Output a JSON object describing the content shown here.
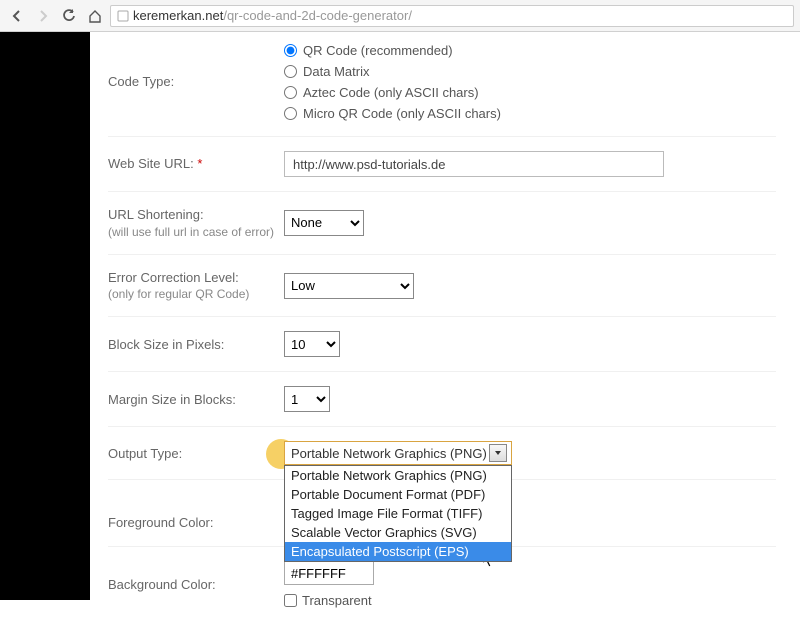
{
  "browser": {
    "url_host": "keremerkan.net",
    "url_path": "/qr-code-and-2d-code-generator/"
  },
  "form": {
    "code_type": {
      "label": "Code Type:",
      "options": [
        "QR Code (recommended)",
        "Data Matrix",
        "Aztec Code (only ASCII chars)",
        "Micro QR Code (only ASCII chars)"
      ]
    },
    "web_url": {
      "label": "Web Site URL:",
      "value": "http://www.psd-tutorials.de"
    },
    "url_shortening": {
      "label": "URL Shortening:",
      "sub": "(will use full url in case of error)",
      "value": "None"
    },
    "error_correction": {
      "label": "Error Correction Level:",
      "sub": "(only for regular QR Code)",
      "value": "Low"
    },
    "block_size": {
      "label": "Block Size in Pixels:",
      "value": "10"
    },
    "margin_size": {
      "label": "Margin Size in Blocks:",
      "value": "1"
    },
    "output_type": {
      "label": "Output Type:",
      "selected": "Portable Network Graphics (PNG)",
      "options": [
        "Portable Network Graphics (PNG)",
        "Portable Document Format (PDF)",
        "Tagged Image File Format (TIFF)",
        "Scalable Vector Graphics (SVG)",
        "Encapsulated Postscript (EPS)"
      ]
    },
    "fg_color": {
      "label": "Foreground Color:"
    },
    "bg_color": {
      "label": "Background Color:",
      "value": "#FFFFFF",
      "transparent_label": "Transparent"
    }
  }
}
